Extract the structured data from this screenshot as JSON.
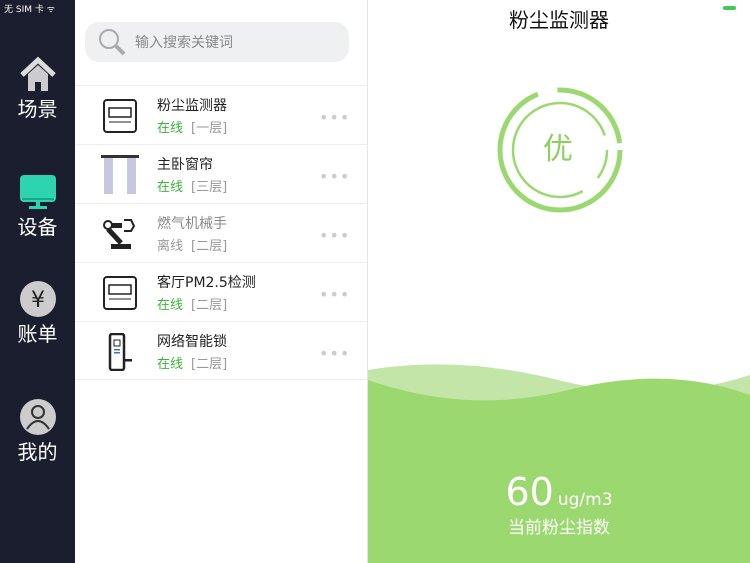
{
  "status_bar": {
    "carrier": "无 SIM 卡 ᯤ"
  },
  "sidebar": {
    "items": [
      {
        "label": "场景"
      },
      {
        "label": "设备"
      },
      {
        "label": "账单"
      },
      {
        "label": "我的"
      }
    ]
  },
  "search": {
    "placeholder": "输入搜索关键词"
  },
  "devices": [
    {
      "name": "粉尘监测器",
      "status": "在线",
      "floor": "[一层]"
    },
    {
      "name": "主卧窗帘",
      "status": "在线",
      "floor": "[三层]"
    },
    {
      "name": "燃气机械手",
      "status": "离线",
      "floor": "[二层]"
    },
    {
      "name": "客厅PM2.5检测",
      "status": "在线",
      "floor": "[二层]"
    },
    {
      "name": "网络智能锁",
      "status": "在线",
      "floor": "[二层]"
    }
  ],
  "more": "•••",
  "detail": {
    "title": "粉尘监测器",
    "grade": "优",
    "value": "60",
    "unit": "ug/m3",
    "caption": "当前粉尘指数"
  },
  "colors": {
    "sidebar": "#1b1e2e",
    "accent": "#2ed3b0",
    "green": "#9bd86f"
  }
}
